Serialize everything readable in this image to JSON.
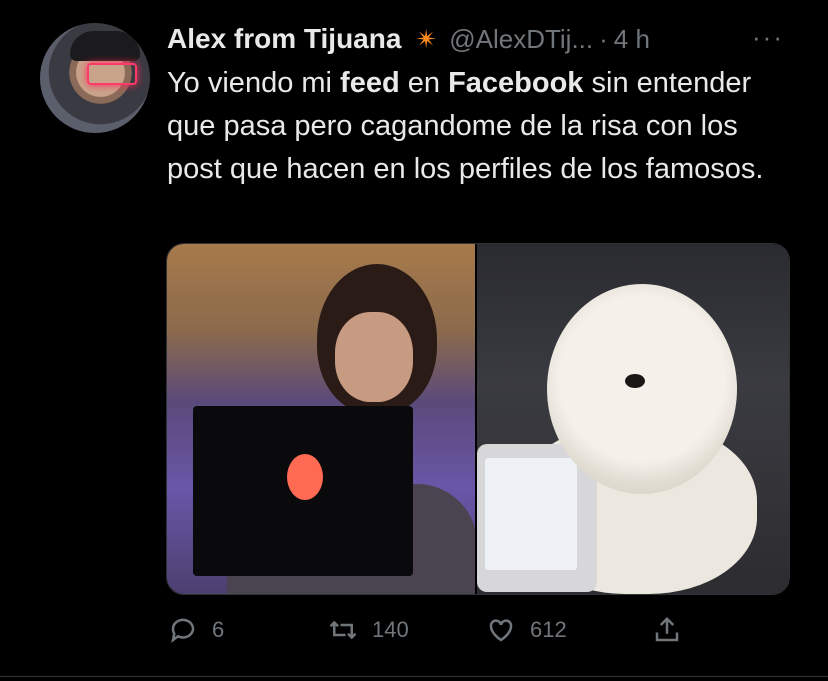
{
  "tweet": {
    "author_name": "Alex from Tijuana",
    "badge_icon": "explosion-icon",
    "handle": "@AlexDTij...",
    "separator": "·",
    "time": "4 h",
    "more": "···",
    "text_parts": [
      "Yo viendo mi ",
      "feed",
      " en ",
      "Facebook",
      " sin entender que pasa pero cagandome de la risa con los post que hacen  en los perfiles de los famosos."
    ]
  },
  "media": [
    {
      "name": "meme-photo-girl-laptop"
    },
    {
      "name": "meme-photo-dog-tablet"
    }
  ],
  "actions": {
    "reply_count": "6",
    "retweet_count": "140",
    "like_count": "612"
  },
  "colors": {
    "background": "#000000",
    "text": "#e7e9ea",
    "muted": "#71767b",
    "badge": "#ff8c1a"
  }
}
